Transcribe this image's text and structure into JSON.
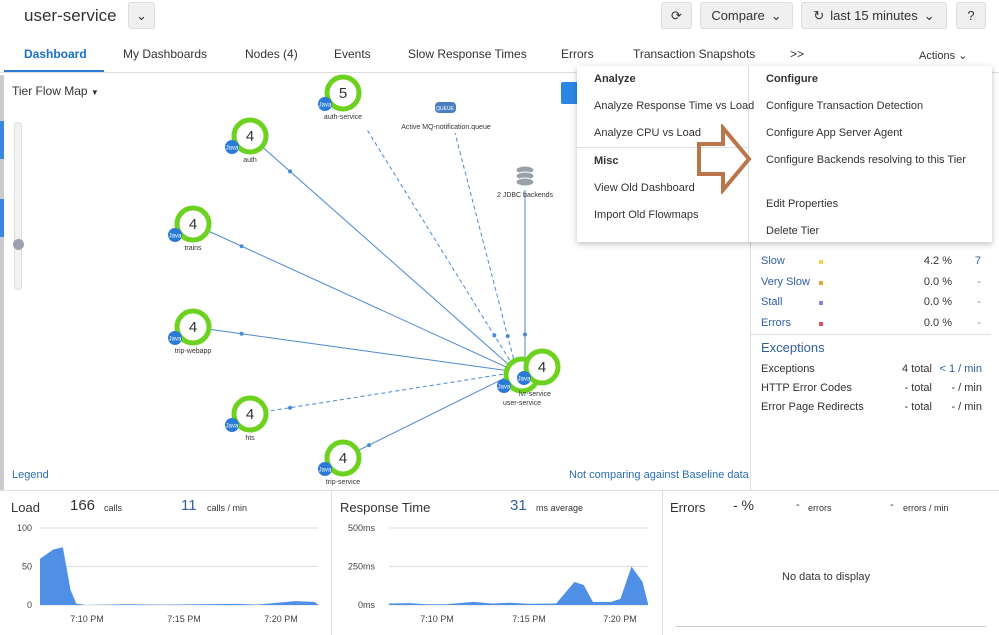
{
  "header": {
    "title": "user-service",
    "compare": "Compare",
    "time_range": "last 15 minutes",
    "help": "?"
  },
  "tabs": [
    {
      "label": "Dashboard",
      "active": true
    },
    {
      "label": "My Dashboards"
    },
    {
      "label": "Nodes (4)"
    },
    {
      "label": "Events"
    },
    {
      "label": "Slow Response Times"
    },
    {
      "label": "Errors"
    },
    {
      "label": "Transaction Snapshots"
    },
    {
      "label": ">>"
    }
  ],
  "actions_label": "Actions",
  "flowmap": {
    "selector": "Tier Flow Map",
    "legend": "Legend",
    "baseline": "Not comparing against Baseline data",
    "badge": "Java",
    "ring_color": "#6cd21f",
    "nodes": [
      {
        "name": "auth-service",
        "count": "5"
      },
      {
        "name": "auth",
        "count": "4"
      },
      {
        "name": "trains",
        "count": "4"
      },
      {
        "name": "trip-webapp",
        "count": "4"
      },
      {
        "name": "hts",
        "count": "4"
      },
      {
        "name": "trip-service",
        "count": "4"
      },
      {
        "name": "user-service",
        "count": ""
      },
      {
        "name": "lvr-service",
        "count": "4"
      }
    ],
    "queue": {
      "name": "Active MQ-notification.queue",
      "icon_text": "QUEUE"
    },
    "db": {
      "name": "2 JDBC backends"
    }
  },
  "menu": {
    "analyze": {
      "heading": "Analyze",
      "items": [
        "Analyze Response Time vs Load",
        "Analyze CPU vs Load"
      ]
    },
    "misc": {
      "heading": "Misc",
      "items": [
        "View Old Dashboard",
        "Import Old Flowmaps"
      ]
    },
    "configure": {
      "heading": "Configure",
      "items": [
        "Configure Transaction Detection",
        "Configure App Server Agent",
        "Configure Backends resolving to this Tier",
        "Edit Properties",
        "Delete Tier"
      ]
    }
  },
  "stats": [
    {
      "label": "Slow",
      "pct": "4.2 %",
      "count": "7",
      "color": "#f2d34a"
    },
    {
      "label": "Very Slow",
      "pct": "0.0 %",
      "count": "-",
      "color": "#e8a23a"
    },
    {
      "label": "Stall",
      "pct": "0.0 %",
      "count": "-",
      "color": "#8a84c8"
    },
    {
      "label": "Errors",
      "pct": "0.0 %",
      "count": "-",
      "color": "#d9535f"
    }
  ],
  "exceptions": {
    "heading": "Exceptions",
    "rows": [
      {
        "label": "Exceptions",
        "total": "4 total",
        "rate": "< 1 / min"
      },
      {
        "label": "HTTP Error Codes",
        "total": "- total",
        "rate": "- / min"
      },
      {
        "label": "Error Page Redirects",
        "total": "- total",
        "rate": "- / min"
      }
    ]
  },
  "chart_data": [
    {
      "type": "area",
      "title": "Load",
      "summary": {
        "calls": "166",
        "calls_label": "calls",
        "rate": "11",
        "rate_label": "calls / min"
      },
      "yticks": [
        "100",
        "50",
        "0"
      ],
      "ylim": [
        0,
        100
      ],
      "xticks": [
        "7:10 PM",
        "7:15 PM",
        "7:20 PM"
      ],
      "x": [
        "7:07:36",
        "7:08:18",
        "7:08:48",
        "7:09:12",
        "7:09:30",
        "7:10",
        "7:12",
        "7:14",
        "7:18",
        "7:19",
        "7:21",
        "7:22",
        "7:22:12"
      ],
      "values": [
        60,
        72,
        75,
        20,
        2,
        0,
        1,
        0.5,
        1.5,
        0.5,
        5,
        4,
        1
      ],
      "color": "#4f8fe6"
    },
    {
      "type": "area",
      "title": "Response Time",
      "summary": {
        "avg": "31",
        "avg_label": "ms average"
      },
      "yticks": [
        "500ms",
        "250ms",
        "0ms"
      ],
      "ylim": [
        0,
        500
      ],
      "xticks": [
        "7:10 PM",
        "7:15 PM",
        "7:20 PM"
      ],
      "x": [
        "7:07:24",
        "7:08:30",
        "7:09:30",
        "7:10:30",
        "7:12",
        "7:13",
        "7:14",
        "7:15",
        "7:16:30",
        "7:17:30",
        "7:18",
        "7:18:30",
        "7:19:30",
        "7:20",
        "7:20:36",
        "7:21:12",
        "7:21:30"
      ],
      "values": [
        10,
        12,
        5,
        5,
        20,
        10,
        15,
        8,
        10,
        150,
        130,
        20,
        20,
        40,
        250,
        150,
        10
      ],
      "color": "#4f8fe6"
    },
    {
      "type": "area",
      "title": "Errors",
      "summary": {
        "pct": "- %",
        "errors": "-",
        "errors_label": "errors",
        "rate": "-",
        "rate_label": "errors / min"
      },
      "empty": "No data to display"
    }
  ]
}
